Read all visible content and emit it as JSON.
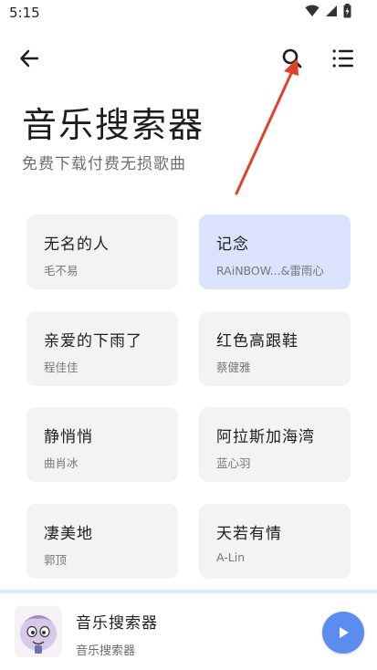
{
  "status_bar": {
    "time": "5:15",
    "icons": [
      "wifi-icon",
      "signal-icon",
      "battery-icon"
    ]
  },
  "top_bar": {
    "icons": [
      "back-arrow-icon",
      "search-icon",
      "list-menu-icon"
    ]
  },
  "page": {
    "title": "音乐搜索器",
    "subtitle": "免费下载付费无损歌曲"
  },
  "songs": [
    {
      "title": "无名的人",
      "artist": "毛不易",
      "selected": false
    },
    {
      "title": "记念",
      "artist": "RAiNBOW...&雷雨心",
      "selected": true
    },
    {
      "title": "亲爱的下雨了",
      "artist": "程佳佳",
      "selected": false
    },
    {
      "title": "红色高跟鞋",
      "artist": "蔡健雅",
      "selected": false
    },
    {
      "title": "静悄悄",
      "artist": "曲肖冰",
      "selected": false
    },
    {
      "title": "阿拉斯加海湾",
      "artist": "蓝心羽",
      "selected": false
    },
    {
      "title": "凄美地",
      "artist": "郭顶",
      "selected": false
    },
    {
      "title": "天若有情",
      "artist": "A-Lin",
      "selected": false
    }
  ],
  "player": {
    "title": "音乐搜索器",
    "subtitle": "音乐搜索器",
    "icons": [
      "album-art-icon",
      "play-icon"
    ]
  },
  "colors": {
    "accent": "#5b8def",
    "selected_card": "#dbe2fb",
    "card": "#f3f3f3",
    "annotation_arrow": "#e0412f"
  }
}
